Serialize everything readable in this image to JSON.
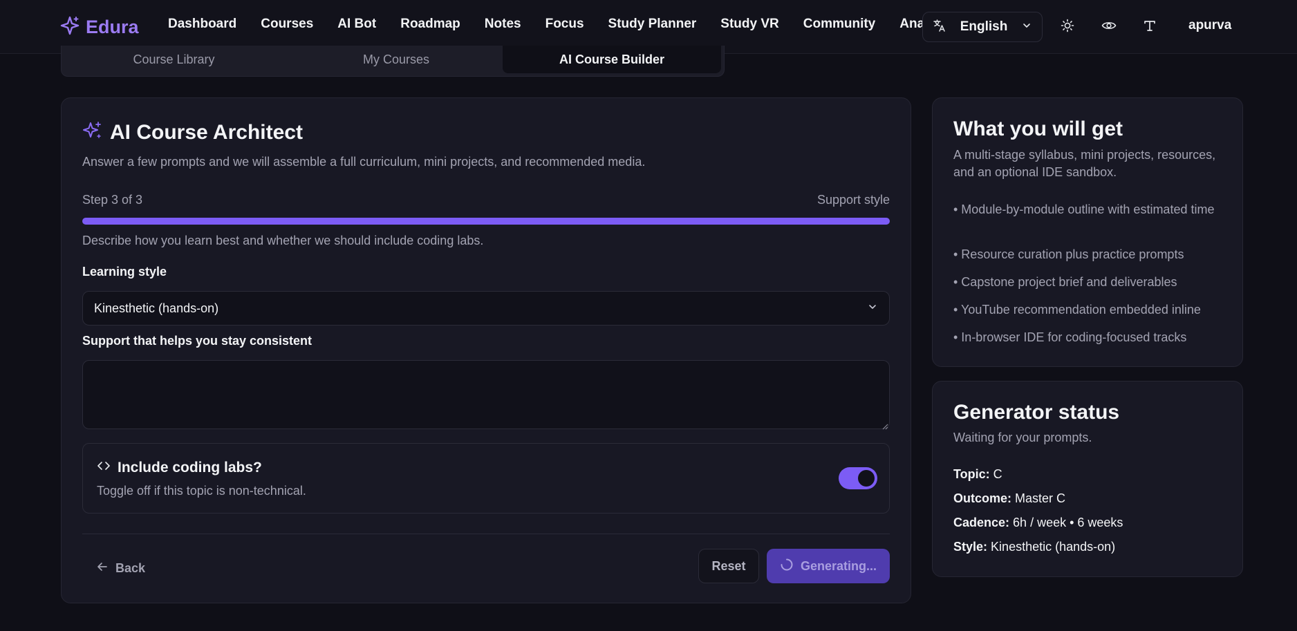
{
  "nav": {
    "brand": "Edura",
    "links": [
      "Dashboard",
      "Courses",
      "AI Bot",
      "Roadmap",
      "Notes",
      "Focus",
      "Study Planner",
      "Study VR",
      "Community",
      "Analytics"
    ],
    "language": "English",
    "username": "apurva",
    "accent": "#9b7bf2"
  },
  "tabs": {
    "library": "Course Library",
    "mine": "My Courses",
    "builder": "AI Course Builder"
  },
  "builder": {
    "title": "AI Course Architect",
    "subtitle": "Answer a few prompts and we will assemble a full curriculum, mini projects, and recommended media.",
    "step_label": "Step 3 of 3",
    "step_name": "Support style",
    "progress_percent": 100,
    "description": "Describe how you learn best and whether we should include coding labs.",
    "learning_style_label": "Learning style",
    "learning_style_value": "Kinesthetic (hands-on)",
    "support_label": "Support that helps you stay consistent",
    "support_value": "",
    "labs_title": "Include coding labs?",
    "labs_sub": "Toggle off if this topic is non-technical.",
    "labs_enabled": true,
    "back_label": "Back",
    "reset_label": "Reset",
    "generate_label": "Generating..."
  },
  "get": {
    "title": "What you will get",
    "subtitle": "A multi-stage syllabus, mini projects, resources, and an optional IDE sandbox.",
    "items": [
      "• Module-by-module outline with estimated time",
      "• Resource curation plus practice prompts",
      "• Capstone project brief and deliverables",
      "• YouTube recommendation embedded inline",
      "• In-browser IDE for coding-focused tracks"
    ]
  },
  "status": {
    "title": "Generator status",
    "subtitle": "Waiting for your prompts.",
    "topic_key": "Topic:",
    "topic_val": "C",
    "outcome_key": "Outcome:",
    "outcome_val": "Master C",
    "cadence_key": "Cadence:",
    "cadence_val": "6h / week • 6 weeks",
    "style_key": "Style:",
    "style_val": "Kinesthetic (hands-on)"
  }
}
